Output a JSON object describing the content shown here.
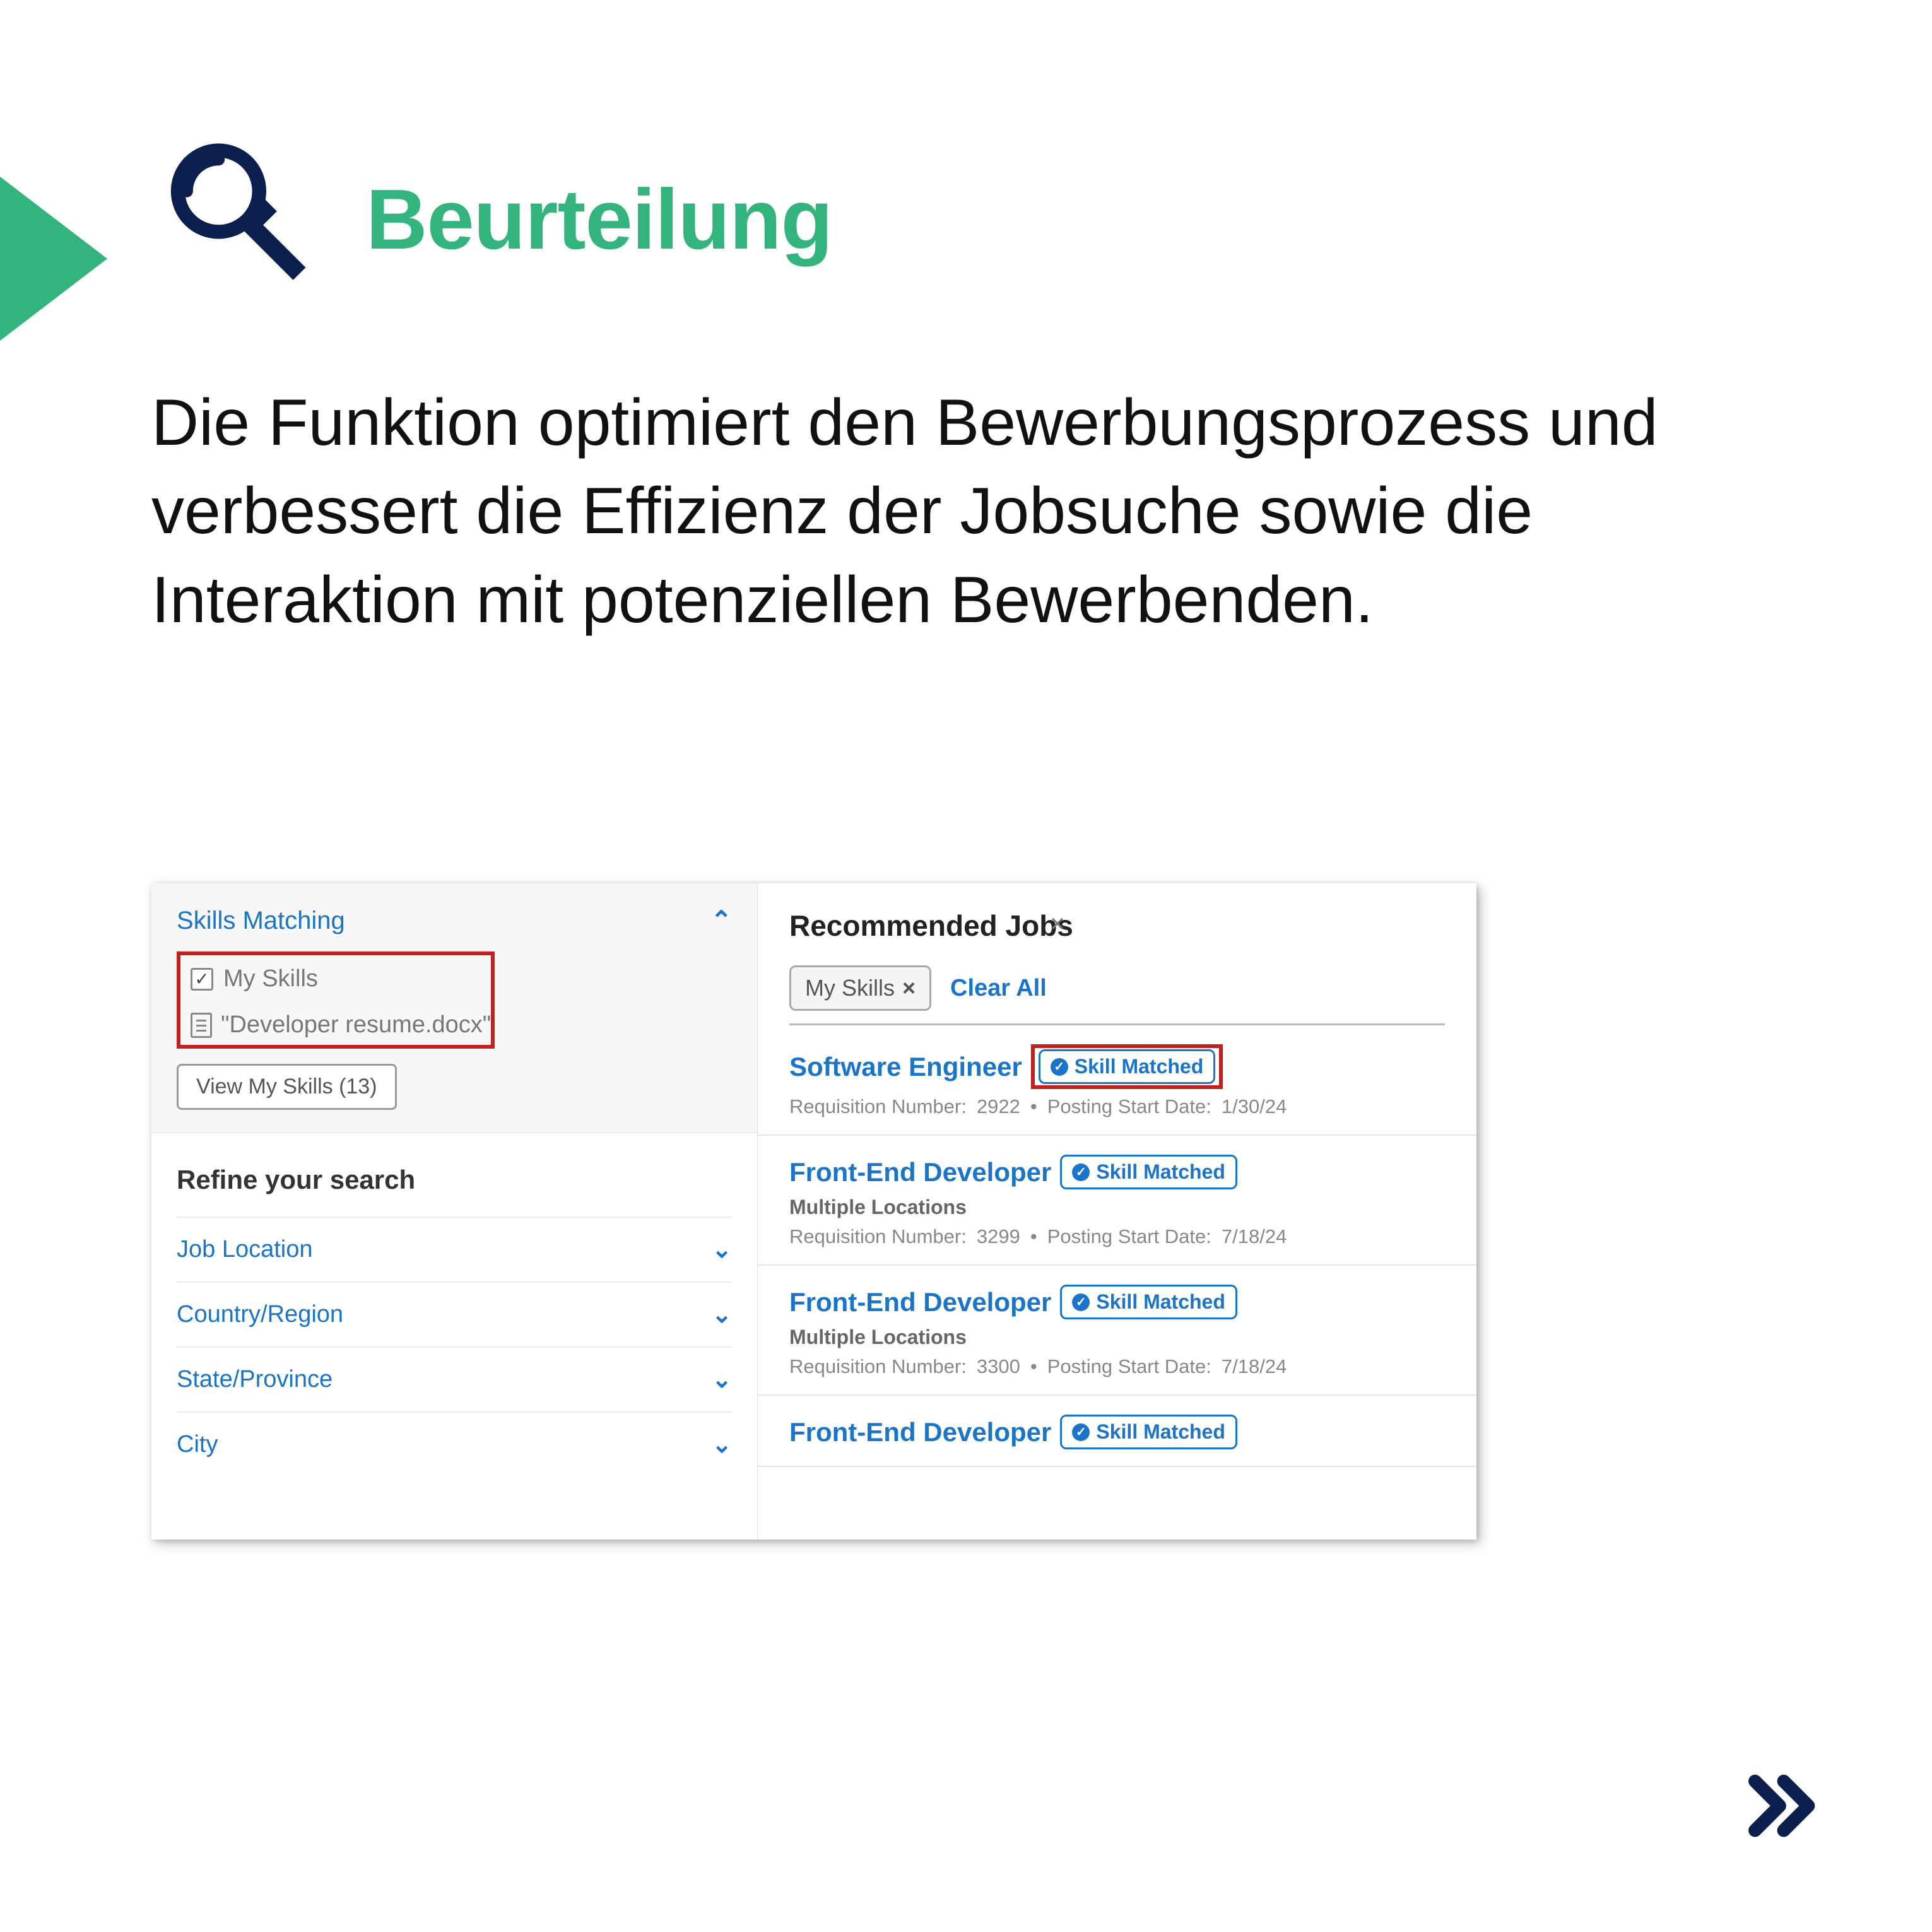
{
  "header": {
    "title": "Beurteilung"
  },
  "description": "Die Funktion optimiert den Bewerbungs­prozess und verbessert die Effizienz der Jobsuche sowie die Interaktion mit poten­ziellen Bewerbenden.",
  "screenshot": {
    "skills_matching_label": "Skills Matching",
    "my_skills_label": "My Skills",
    "resume_file": "\"Developer resume.docx\"",
    "view_skills_btn": "View My Skills (13)",
    "refine_label": "Refine your search",
    "filters": [
      "Job Location",
      "Country/Region",
      "State/Province",
      "City"
    ],
    "recommended_label": "Recommended Jobs",
    "chip_label": "My Skills",
    "clear_all": "Clear All",
    "badge_text": "Skill Matched",
    "jobs": [
      {
        "title": "Software Engineer",
        "subtitle": "",
        "req_label": "Requisition Number:",
        "req": "2922",
        "date_label": "Posting Start Date:",
        "date": "1/30/24",
        "highlight": true
      },
      {
        "title": "Front-End Developer",
        "subtitle": "Multiple Locations",
        "req_label": "Requisition Number:",
        "req": "3299",
        "date_label": "Posting Start Date:",
        "date": "7/18/24",
        "highlight": false
      },
      {
        "title": "Front-End Developer",
        "subtitle": "Multiple Locations",
        "req_label": "Requisition Number:",
        "req": "3300",
        "date_label": "Posting Start Date:",
        "date": "7/18/24",
        "highlight": false
      },
      {
        "title": "Front-End Developer",
        "subtitle": "",
        "req_label": "",
        "req": "",
        "date_label": "",
        "date": "",
        "highlight": false
      }
    ]
  }
}
